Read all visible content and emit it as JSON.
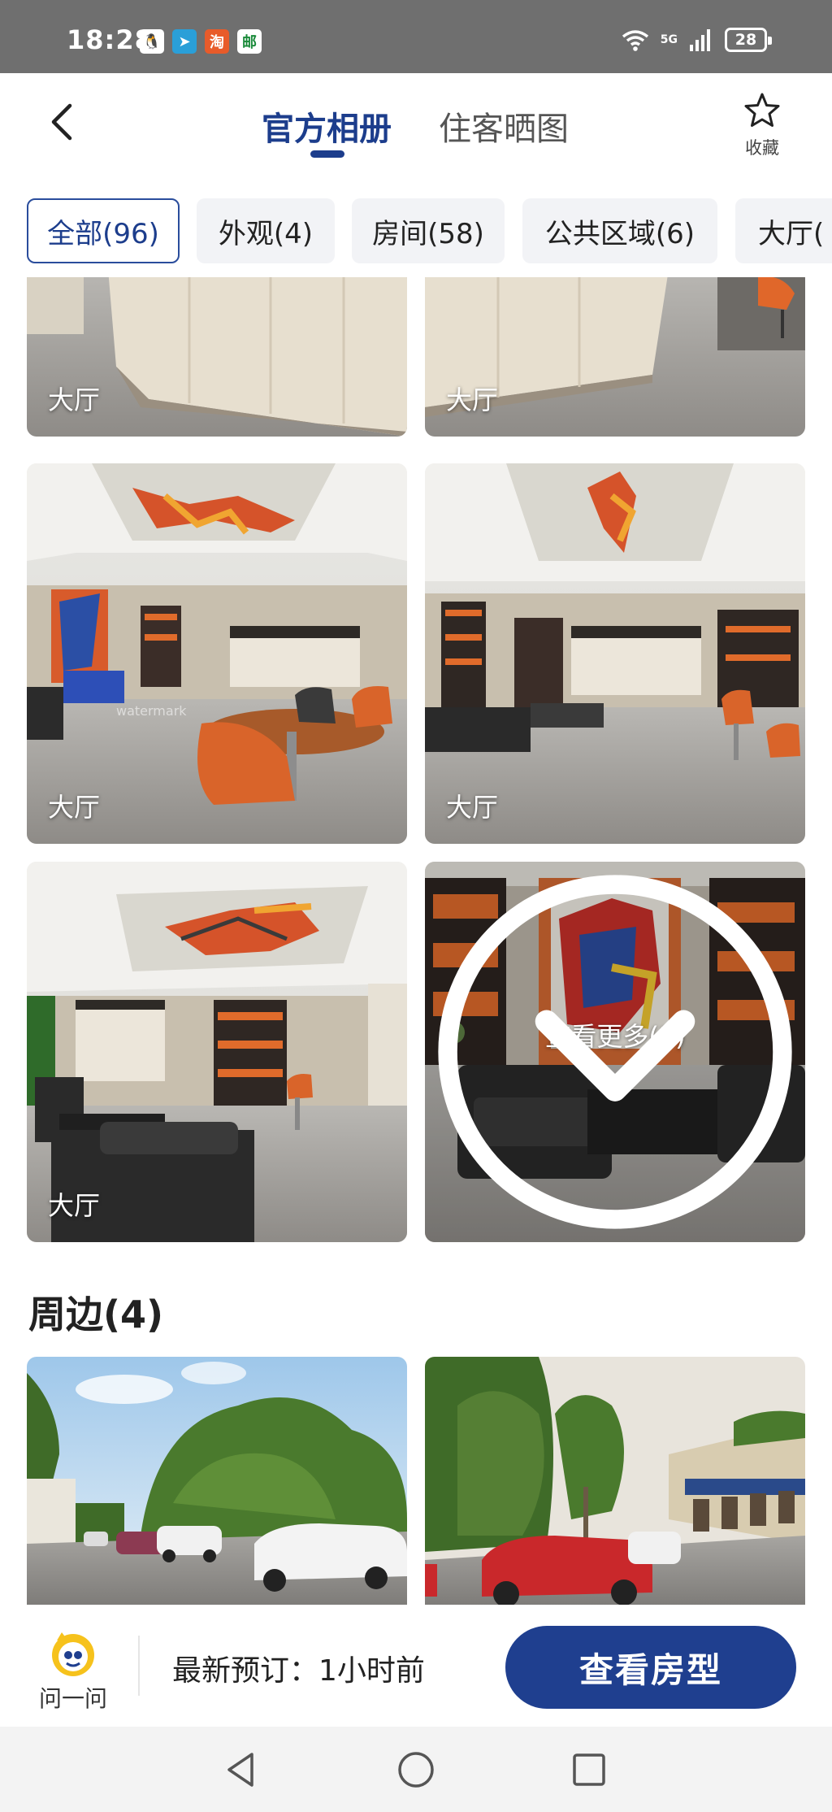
{
  "status_bar": {
    "time": "18:28",
    "network": "5G",
    "battery": "28",
    "apps": [
      "qq-icon",
      "telegram-icon",
      "shopping-app-icon",
      "china-post-icon"
    ]
  },
  "header": {
    "tabs": [
      {
        "label": "官方相册",
        "active": true
      },
      {
        "label": "住客晒图",
        "active": false
      }
    ],
    "favorite_label": "收藏"
  },
  "filter_chips": [
    {
      "label": "全部(96)",
      "active": true
    },
    {
      "label": "外观(4)",
      "active": false
    },
    {
      "label": "房间(58)",
      "active": false
    },
    {
      "label": "公共区域(6)",
      "active": false
    },
    {
      "label": "大厅(",
      "active": false
    }
  ],
  "gallery": {
    "photos": [
      {
        "label": "大厅"
      },
      {
        "label": "大厅"
      },
      {
        "label": "大厅"
      },
      {
        "label": "大厅"
      },
      {
        "label": "大厅"
      }
    ],
    "more_label": "查看更多(3)",
    "surroundings_title": "周边(4)"
  },
  "bottom_bar": {
    "ask_label": "问一问",
    "latest_booking": "最新预订：1小时前",
    "view_rooms_label": "查看房型"
  },
  "colors": {
    "brand_blue": "#1f3f8f",
    "status_bar": "#6f6f6f"
  }
}
